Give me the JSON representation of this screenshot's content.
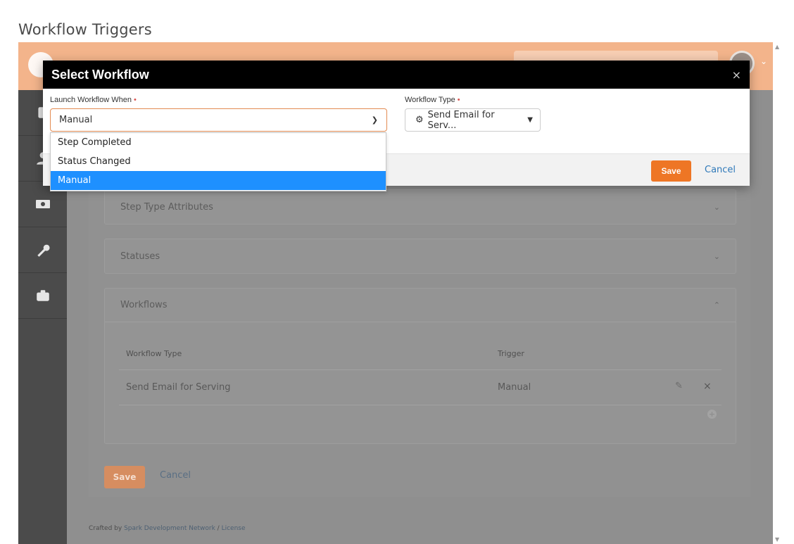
{
  "page": {
    "heading": "Workflow Triggers"
  },
  "sections": {
    "step_type_attributes": "Step Type Attributes",
    "statuses": "Statuses",
    "workflows": "Workflows"
  },
  "grid": {
    "headers": [
      "Workflow Type",
      "Trigger"
    ],
    "rows": [
      {
        "workflow_type": "Send Email for Serving",
        "trigger": "Manual"
      }
    ]
  },
  "page_actions": {
    "save": "Save",
    "cancel": "Cancel"
  },
  "footer": {
    "prefix": "Crafted by ",
    "link": "Spark Development Network",
    "sep": " / ",
    "license": "License"
  },
  "modal": {
    "title": "Select Workflow",
    "close": "×",
    "launch_label": "Launch Workflow When",
    "launch_value": "Manual",
    "workflow_type_label": "Workflow Type",
    "workflow_type_value": "Send Email for Serv...",
    "save": "Save",
    "cancel": "Cancel",
    "options": [
      "Step Completed",
      "Status Changed",
      "Manual"
    ],
    "selected_option": "Manual"
  },
  "icons": {
    "close": "close-icon",
    "select_arrow": "chevron-down-icon",
    "workflow_cog": "cogs-icon",
    "edit": "pencil-icon",
    "delete": "times-icon",
    "add": "plus-circle-icon"
  },
  "colors": {
    "accent": "#ee7625",
    "link": "#2f79b9",
    "selected": "#1e90ff",
    "modal_header": "#000000"
  }
}
